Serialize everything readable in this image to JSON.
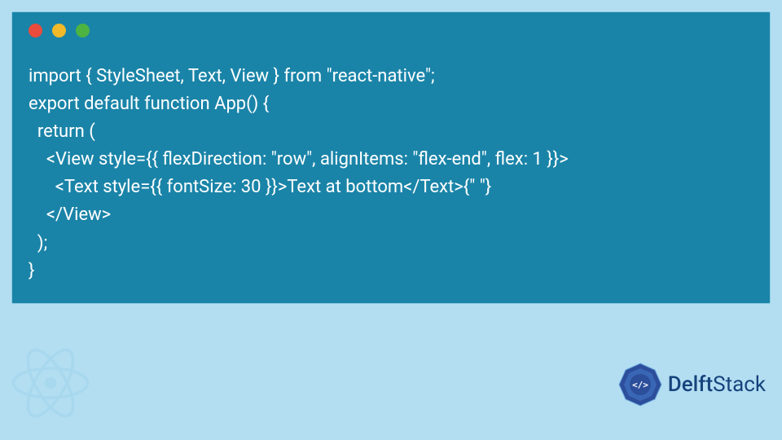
{
  "code": {
    "lines": [
      "import { StyleSheet, Text, View } from \"react-native\";",
      "export default function App() {",
      "  return (",
      "    <View style={{ flexDirection: \"row\", alignItems: \"flex-end\", flex: 1 }}>",
      "      <Text style={{ fontSize: 30 }}>Text at bottom</Text>{\" \"}",
      "    </View>",
      "  );",
      "}"
    ]
  },
  "brand": {
    "name_left": "Delft",
    "name_right": "Stack"
  },
  "colors": {
    "page_bg": "#b3def2",
    "code_bg": "#1a84a8",
    "code_fg": "#ffffff",
    "brand_text": "#16437c",
    "brand_badge": "#2c4e9b"
  }
}
